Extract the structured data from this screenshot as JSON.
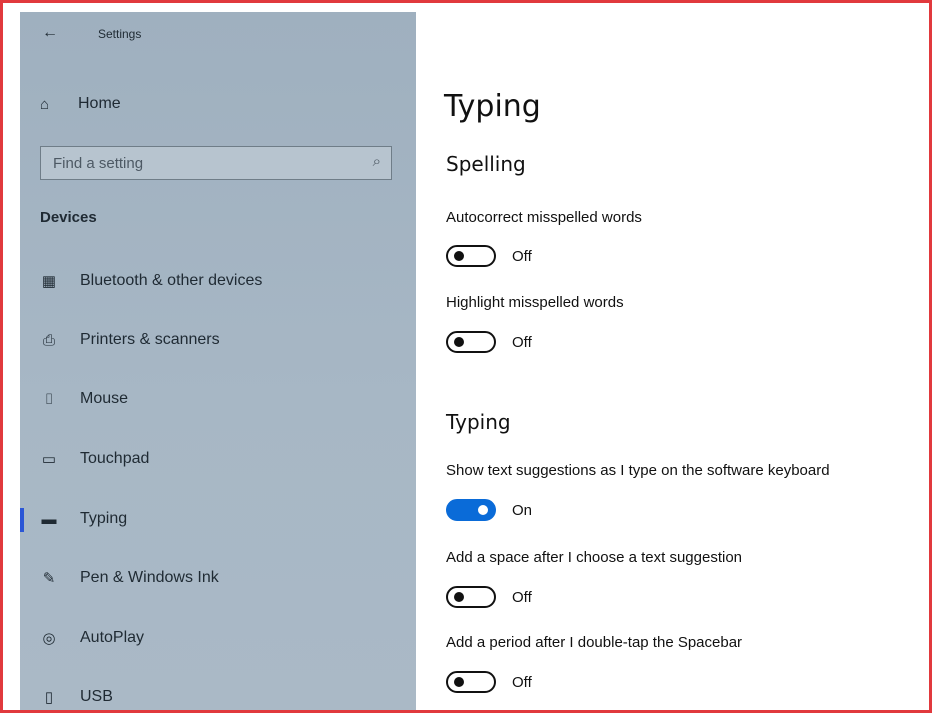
{
  "window": {
    "title": "Settings",
    "back_icon": "back-arrow-icon"
  },
  "sidebar": {
    "home": {
      "label": "Home",
      "icon": "home-icon"
    },
    "search": {
      "placeholder": "Find a setting",
      "icon": "search-icon"
    },
    "section": "Devices",
    "items": [
      {
        "label": "Bluetooth & other devices",
        "icon": "bluetooth-devices-icon"
      },
      {
        "label": "Printers & scanners",
        "icon": "printer-icon"
      },
      {
        "label": "Mouse",
        "icon": "mouse-icon"
      },
      {
        "label": "Touchpad",
        "icon": "touchpad-icon"
      },
      {
        "label": "Typing",
        "icon": "keyboard-icon",
        "active": true
      },
      {
        "label": "Pen & Windows Ink",
        "icon": "pen-icon"
      },
      {
        "label": "AutoPlay",
        "icon": "autoplay-icon"
      },
      {
        "label": "USB",
        "icon": "usb-icon"
      }
    ]
  },
  "content": {
    "title": "Typing",
    "spelling": {
      "heading": "Spelling",
      "settings": [
        {
          "label": "Autocorrect misspelled words",
          "state": "Off"
        },
        {
          "label": "Highlight misspelled words",
          "state": "Off"
        }
      ]
    },
    "typing": {
      "heading": "Typing",
      "settings": [
        {
          "label": "Show text suggestions as I type on the software keyboard",
          "state": "On"
        },
        {
          "label": "Add a space after I choose a text suggestion",
          "state": "Off"
        },
        {
          "label": "Add a period after I double-tap the Spacebar",
          "state": "Off"
        }
      ]
    }
  },
  "colors": {
    "accent": "#0a6bd8",
    "sidebar_bg": "#a7b7c5",
    "frame": "#e1393d"
  }
}
